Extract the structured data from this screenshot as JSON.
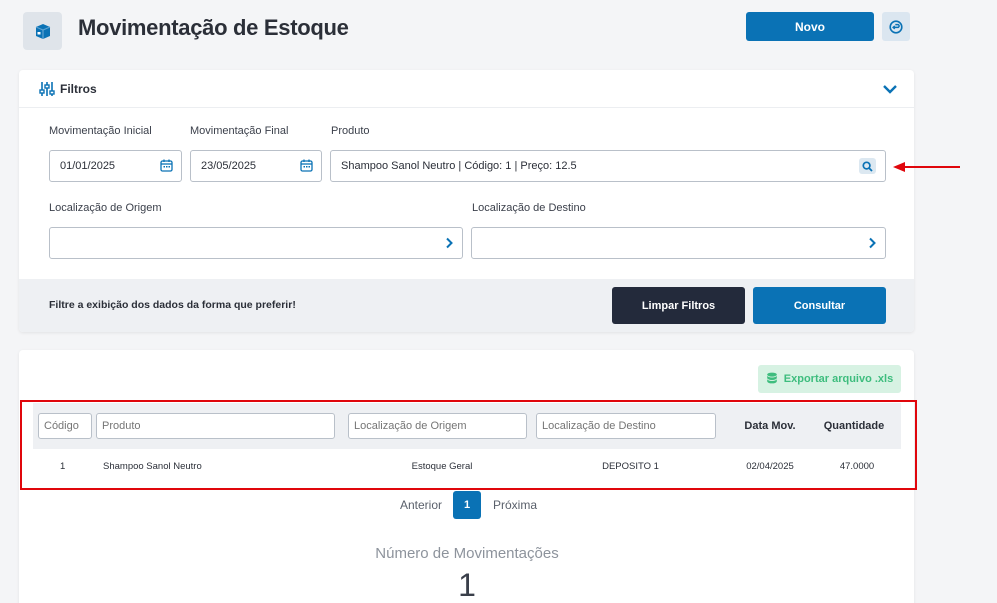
{
  "page": {
    "title": "Movimentação de Estoque",
    "new_label": "Novo"
  },
  "filters": {
    "title": "Filtros",
    "mov_inicial_label": "Movimentação Inicial",
    "mov_inicial_value": "01/01/2025",
    "mov_final_label": "Movimentação Final",
    "mov_final_value": "23/05/2025",
    "produto_label": "Produto",
    "produto_value": "Shampoo Sanol Neutro | Código: 1 | Preço: 12.5",
    "origem_label": "Localização de Origem",
    "origem_value": "",
    "destino_label": "Localização de Destino",
    "destino_value": "",
    "hint": "Filtre a exibição dos dados da forma que preferir!",
    "clear_label": "Limpar Filtros",
    "submit_label": "Consultar"
  },
  "results": {
    "export_label": "Exportar arquivo .xls",
    "columns": {
      "codigo": "Código",
      "produto": "Produto",
      "origem": "Localização de Origem",
      "destino": "Localização de Destino",
      "data": "Data Mov.",
      "quantidade": "Quantidade"
    },
    "rows": [
      {
        "codigo": "1",
        "produto": "Shampoo Sanol Neutro",
        "origem": "Estoque Geral",
        "destino": "DEPOSITO 1",
        "data": "02/04/2025",
        "quantidade": "47.0000"
      }
    ],
    "pagination": {
      "prev": "Anterior",
      "current": "1",
      "next": "Próxima"
    },
    "count_label": "Número de Movimentações",
    "count_value": "1"
  },
  "colors": {
    "primary": "#0a72b5",
    "dark": "#232a3b",
    "export_bg": "#d7f2e3",
    "export_text": "#3ebd7e",
    "annotation": "#e0060c"
  },
  "icons": {
    "app": "box-icon",
    "back": "undo-icon",
    "filters": "sliders-icon",
    "collapse": "chevron-down-icon",
    "calendar": "calendar-icon",
    "search": "search-icon",
    "chevron": "chevron-right-icon",
    "export": "database-icon"
  }
}
